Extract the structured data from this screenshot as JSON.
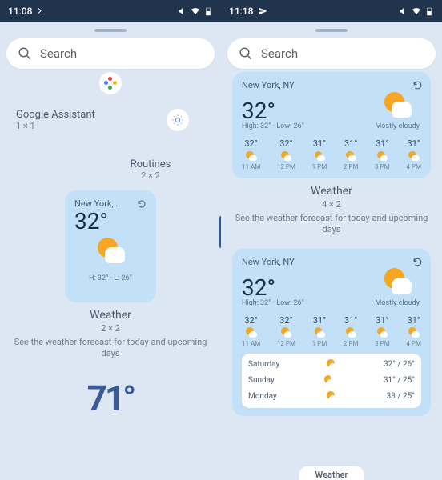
{
  "left": {
    "time": "11:08",
    "search": "Search",
    "assistant": {
      "label": "Google Assistant",
      "size": "1 × 1"
    },
    "routines": {
      "label": "Routines",
      "size": "2 × 2"
    },
    "weather_card": {
      "location": "New York,...",
      "temp": "32°",
      "hl": "H: 32° · L: 26°"
    },
    "weather_caption": "Weather",
    "weather_size": "2 × 2",
    "weather_desc": "See the weather forecast for today and upcoming days",
    "big_temp": "71°"
  },
  "right": {
    "time": "11:18",
    "search": "Search",
    "card1": {
      "location": "New York, NY",
      "temp": "32°",
      "sub": "High: 32° · Low: 26°",
      "cond": "Mostly cloudy",
      "hours": [
        {
          "t": "32°",
          "h": "11 AM"
        },
        {
          "t": "32°",
          "h": "12 PM"
        },
        {
          "t": "31°",
          "h": "1 PM"
        },
        {
          "t": "31°",
          "h": "2 PM"
        },
        {
          "t": "31°",
          "h": "3 PM"
        },
        {
          "t": "31°",
          "h": "4 PM"
        }
      ]
    },
    "caption1": "Weather",
    "size1": "4 × 2",
    "desc1": "See the weather forecast for today and upcoming days",
    "card2": {
      "location": "New York, NY",
      "temp": "32°",
      "sub": "High: 32° · Low: 26°",
      "cond": "Mostly cloudy",
      "hours": [
        {
          "t": "32°",
          "h": "11 AM"
        },
        {
          "t": "32°",
          "h": "12 PM"
        },
        {
          "t": "31°",
          "h": "1 PM"
        },
        {
          "t": "31°",
          "h": "2 PM"
        },
        {
          "t": "31°",
          "h": "3 PM"
        },
        {
          "t": "31°",
          "h": "4 PM"
        }
      ],
      "days": [
        {
          "d": "Saturday",
          "v": "32° / 26°"
        },
        {
          "d": "Sunday",
          "v": "31° / 25°"
        },
        {
          "d": "Monday",
          "v": "33 / 25°"
        }
      ]
    },
    "bottom_tab": "Weather"
  }
}
